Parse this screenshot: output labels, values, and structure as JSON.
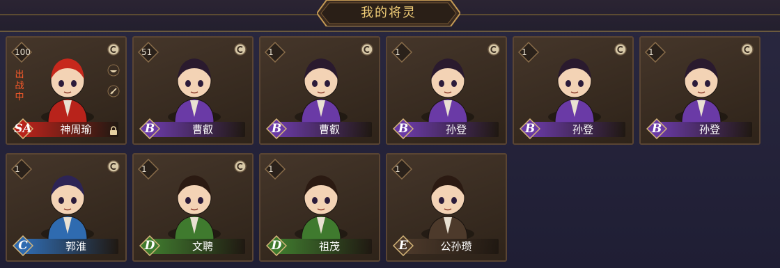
{
  "header": {
    "title": "我的将灵"
  },
  "cards": [
    {
      "level": "100",
      "name": "神周瑜",
      "grade": "SA",
      "status": "出战中",
      "color": "red",
      "extra_icons": [
        "coin-icon",
        "bowl-icon",
        "sword-icon"
      ],
      "locked": true
    },
    {
      "level": "51",
      "name": "曹叡",
      "grade": "B",
      "color": "purple",
      "extra_icons": [
        "coin-icon"
      ]
    },
    {
      "level": "1",
      "name": "曹叡",
      "grade": "B",
      "color": "purple",
      "extra_icons": [
        "coin-icon"
      ]
    },
    {
      "level": "1",
      "name": "孙登",
      "grade": "B",
      "color": "purple",
      "extra_icons": [
        "coin-icon"
      ]
    },
    {
      "level": "1",
      "name": "孙登",
      "grade": "B",
      "color": "purple",
      "extra_icons": [
        "coin-icon"
      ]
    },
    {
      "level": "1",
      "name": "孙登",
      "grade": "B",
      "color": "purple",
      "extra_icons": [
        "coin-icon"
      ]
    },
    {
      "level": "1",
      "name": "郭淮",
      "grade": "C",
      "color": "blue",
      "extra_icons": [
        "coin-icon"
      ]
    },
    {
      "level": "1",
      "name": "文聘",
      "grade": "D",
      "color": "green",
      "extra_icons": [
        "coin-icon"
      ]
    },
    {
      "level": "1",
      "name": "祖茂",
      "grade": "D",
      "color": "green",
      "extra_icons": []
    },
    {
      "level": "1",
      "name": "公孙瓒",
      "grade": "E",
      "color": "brown",
      "extra_icons": []
    }
  ],
  "palette": {
    "red": "#b8231b",
    "purple": "#6a3aa6",
    "blue": "#2f6bb0",
    "green": "#3f7a2e",
    "brown": "#4d3a2b"
  }
}
